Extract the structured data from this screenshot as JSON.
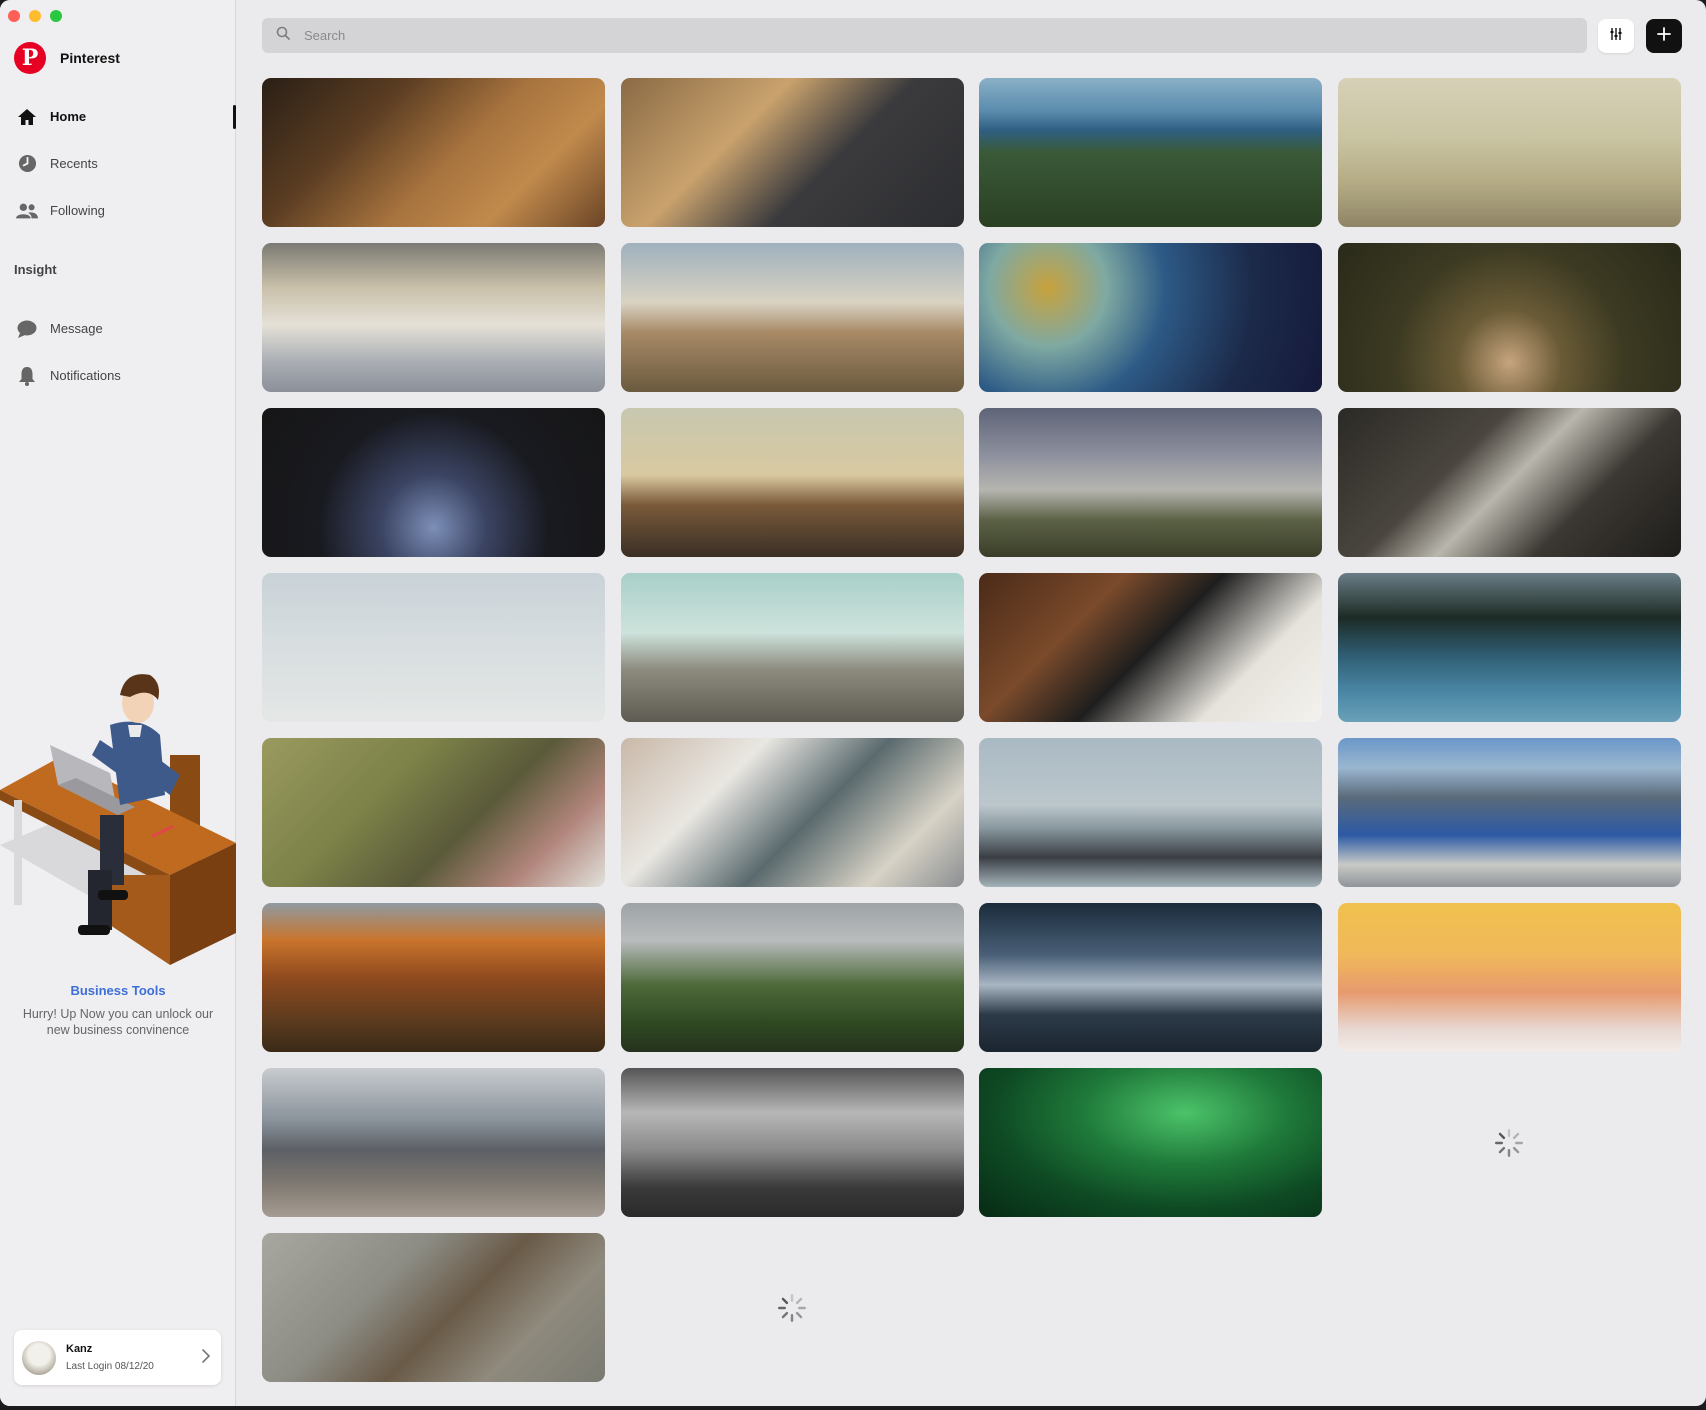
{
  "app": {
    "name": "Pinterest"
  },
  "sidebar": {
    "nav": [
      {
        "label": "Home",
        "icon": "home-icon",
        "active": true
      },
      {
        "label": "Recents",
        "icon": "clock-icon"
      },
      {
        "label": "Following",
        "icon": "people-icon"
      }
    ],
    "section_label": "Insight",
    "nav2": [
      {
        "label": "Message",
        "icon": "chat-bubble-icon"
      },
      {
        "label": "Notifications",
        "icon": "bell-icon"
      }
    ],
    "promo": {
      "title": "Business Tools",
      "description": "Hurry! Up Now you can unlock our new business convinence"
    },
    "user": {
      "name": "Kanz",
      "last_login": "Last Login 08/12/20"
    }
  },
  "search": {
    "placeholder": "Search",
    "value": ""
  },
  "toolbar": {
    "filter_icon": "sliders-icon",
    "add_icon": "plus-icon"
  },
  "colors": {
    "brand": "#e60023",
    "accent_link": "#3d6fd9"
  },
  "pins": [
    {
      "name": "laptop-on-table",
      "bg": "linear-gradient(135deg,#2a1f16 0%,#5b3d22 30%,#a7733e 55%,#c18a4c 75%,#6b4527 100%)"
    },
    {
      "name": "person-typing-laptop",
      "bg": "linear-gradient(135deg,#8a6a45 0%,#c9a26d 35%,#3b3b3e 60%,#2c2d30 100%)"
    },
    {
      "name": "coastal-forest",
      "bg": "linear-gradient(180deg,#8ab0c6 0%,#5b8cae 22%,#2f5f82 35%,#3a5a38 50%,#2a3f22 100%)"
    },
    {
      "name": "foggy-beach",
      "bg": "linear-gradient(180deg,#d6d1b7 0%,#c9c4a2 40%,#b5ac86 70%,#8f8566 100%)"
    },
    {
      "name": "snowy-cross-hill",
      "bg": "linear-gradient(180deg,#7c7a73 0%,#c9c0a9 30%,#e5e1d8 55%,#a9adb3 80%,#8b9099 100%)"
    },
    {
      "name": "father-child-beach",
      "bg": "linear-gradient(180deg,#9fb0bd 0%,#d9d3c3 40%,#a88a66 60%,#6a5a3f 100%)"
    },
    {
      "name": "aerial-coast-gold",
      "bg": "radial-gradient(circle at 20% 30%,#c8a23c 0%,#7fa9a2 20%,#2d5a86 40%,#1c2a4a 70%,#15193a 100%)"
    },
    {
      "name": "fawn-in-forest",
      "bg": "radial-gradient(circle at 50% 80%,#c6a47e 0%,#6a5b36 25%,#3c3a22 55%,#2a2a1a 100%)"
    },
    {
      "name": "couple-in-rain",
      "bg": "radial-gradient(circle at 50% 80%,#7d8fb8 0%,#3b4463 25%,#191a20 55%,#161616 100%)"
    },
    {
      "name": "woman-scarf-sunset",
      "bg": "linear-gradient(180deg,#c7c7b0 0%,#d9c9a0 45%,#7a5a3a 65%,#3a2f26 100%)"
    },
    {
      "name": "misty-mountain-person",
      "bg": "linear-gradient(180deg,#5f6478 0%,#8a8e9c 30%,#b6b5b0 55%,#5c6246 75%,#3a3e29 100%)"
    },
    {
      "name": "woman-sofa-window",
      "bg": "linear-gradient(135deg,#2c2a26 0%,#4a463f 35%,#b9b6ad 50%,#3b3833 70%,#1f1d1a 100%)"
    },
    {
      "name": "pale-sky",
      "bg": "linear-gradient(180deg,#c9d2d8 0%,#d8dee0 50%,#e4e7e5 100%)"
    },
    {
      "name": "concrete-tower-sky",
      "bg": "linear-gradient(180deg,#a9cfc9 0%,#cde3dc 40%,#8d8a7e 65%,#5e5b52 100%)"
    },
    {
      "name": "child-reading-bible",
      "bg": "linear-gradient(135deg,#4a2a18 0%,#7a4a2a 30%,#1e1e1e 50%,#e6e3dc 75%,#f4f2ee 100%)"
    },
    {
      "name": "woman-canoe-lake",
      "bg": "linear-gradient(180deg,#6a7d86 0%,#1d2b25 30%,#2f5d72 55%,#4a87a5 80%,#6aa0b8 100%)"
    },
    {
      "name": "couple-dog-grass",
      "bg": "linear-gradient(135deg,#9a9a5f 0%,#7c8248 35%,#5a5a3a 60%,#b0847a 80%,#e1e1dc 100%)"
    },
    {
      "name": "car-window-woman",
      "bg": "linear-gradient(135deg,#c9b8a8 0%,#e9e7e2 30%,#5a6a6e 55%,#d8d2c6 80%,#8a8f91 100%)"
    },
    {
      "name": "blindfolded-woman",
      "bg": "linear-gradient(180deg,#a9b9c3 0%,#bcc7cc 45%,#8a9aa0 60%,#3a3e44 80%,#a4b4ba 100%)"
    },
    {
      "name": "fjord-cliffs",
      "bg": "linear-gradient(180deg,#6a97c9 0%,#9ab6cf 20%,#5a6a7a 40%,#2c5aa5 65%,#c8cac6 85%,#8f949a 100%)"
    },
    {
      "name": "orange-canyon",
      "bg": "linear-gradient(180deg,#8f9aa2 0%,#c9742c 25%,#8f4a1e 50%,#5a3a1e 80%,#3a2a18 100%)"
    },
    {
      "name": "green-cliffs",
      "bg": "linear-gradient(180deg,#9ea3a6 0%,#b9bcbd 25%,#4e6a3a 55%,#2f4a22 80%,#25321e 100%)"
    },
    {
      "name": "stormy-sea",
      "bg": "linear-gradient(180deg,#1a2a3a 0%,#4a6078 35%,#a9b6c3 55%,#2c3a48 75%,#1b2530 100%)"
    },
    {
      "name": "raspberries-table",
      "bg": "linear-gradient(180deg,#f0c14e 0%,#f0b85a 35%,#e79a6e 60%,#e7d8d3 85%,#f2ece8 100%)"
    },
    {
      "name": "bear-snowy-hill",
      "bg": "linear-gradient(180deg,#c8ccd0 0%,#8a929a 35%,#5c6066 55%,#7a756e 75%,#a59c92 100%)"
    },
    {
      "name": "misty-forest-bw",
      "bg": "linear-gradient(180deg,#555 0%,#b7b7b7 30%,#8a8a8a 55%,#3a3a3a 80%,#2a2a2a 100%)"
    },
    {
      "name": "aurora-night",
      "bg": "radial-gradient(ellipse at 60% 30%,#4cc36a 0%,#1f7a3a 35%,#0e4a24 65%,#072a14 100%)"
    },
    {
      "name": "loading"
    },
    {
      "name": "vulture-flying",
      "bg": "linear-gradient(135deg,#a8a8a0 0%,#8c8c84 35%,#6a5a48 55%,#8f8a7d 75%,#7a7a72 100%)"
    },
    {
      "name": "loading"
    }
  ]
}
